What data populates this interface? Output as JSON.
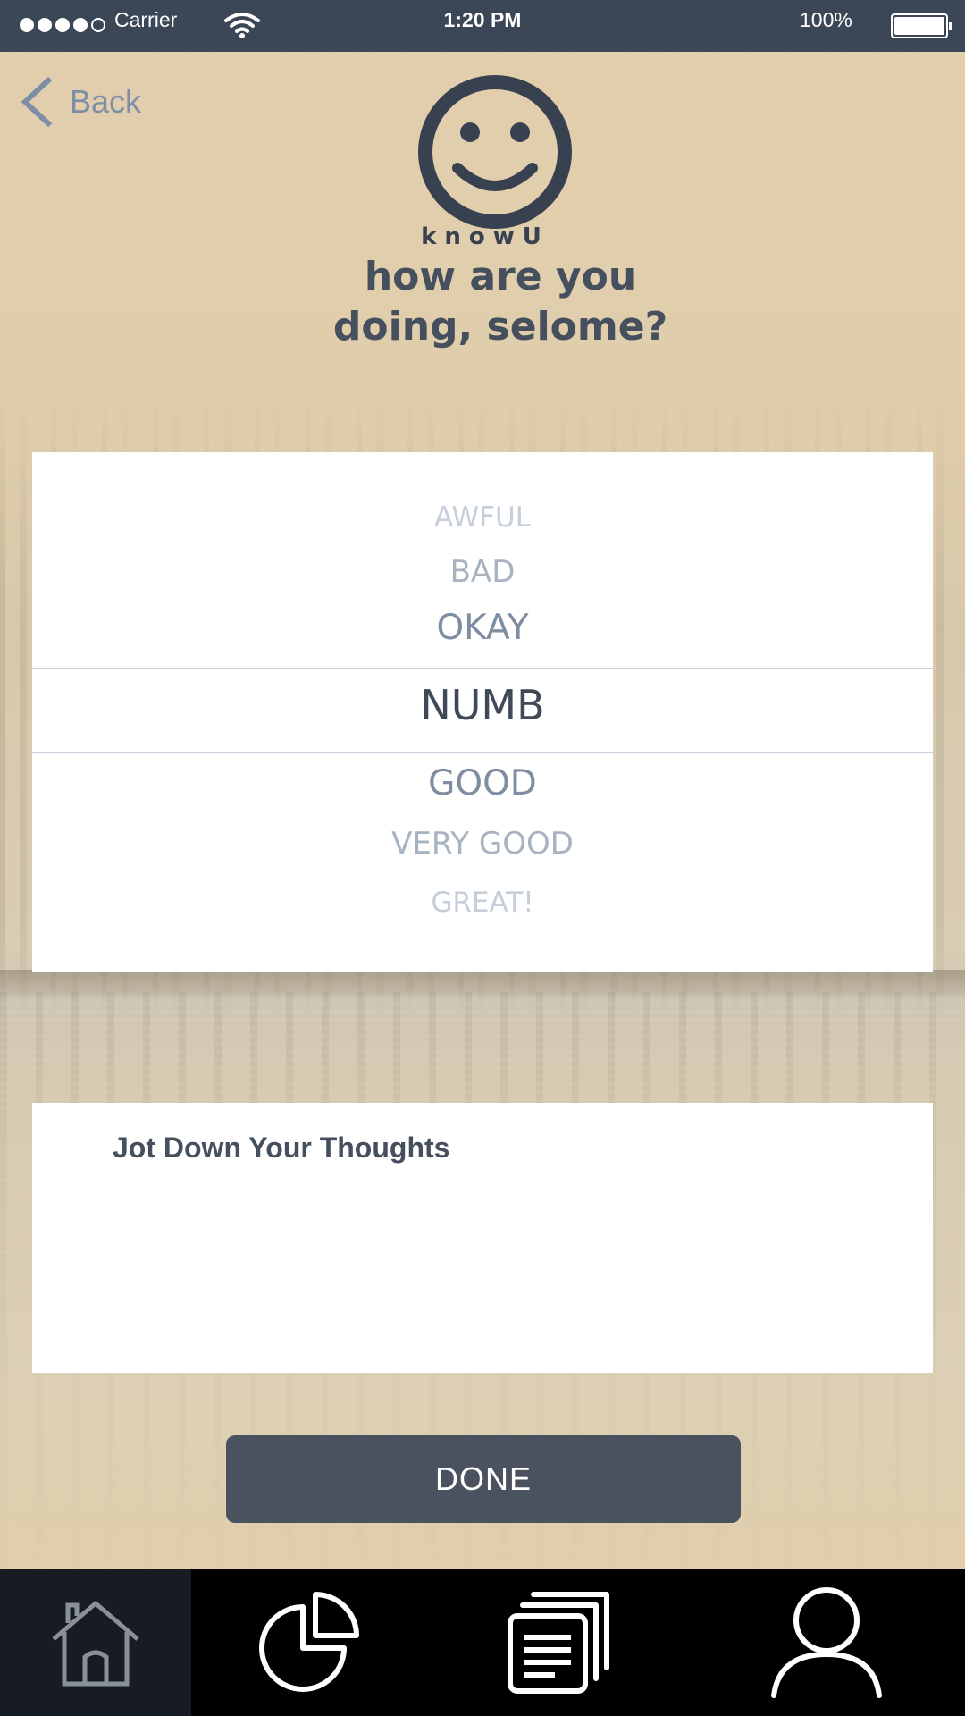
{
  "status_bar": {
    "carrier": "Carrier",
    "time": "1:20 PM",
    "battery": "100%",
    "signal_strength": 4
  },
  "header": {
    "back_label": "Back",
    "brand": "knowU",
    "greeting": "how are you doing, selome?"
  },
  "mood_picker": {
    "options": [
      "AWFUL",
      "BAD",
      "OKAY",
      "NUMB",
      "GOOD",
      "VERY GOOD",
      "GREAT!"
    ],
    "selected": "NUMB"
  },
  "thoughts": {
    "label": "Jot Down Your Thoughts",
    "value": ""
  },
  "actions": {
    "done_label": "DONE"
  },
  "tab_bar": {
    "tabs": [
      {
        "icon": "home-icon",
        "active": true
      },
      {
        "icon": "pie-chart-icon",
        "active": false
      },
      {
        "icon": "documents-icon",
        "active": false
      },
      {
        "icon": "profile-icon",
        "active": false
      }
    ]
  },
  "colors": {
    "status_bar_bg": "#3b4656",
    "accent": "#4a5260",
    "back_link": "#7d8ea6",
    "tab_bar_bg": "#000000"
  }
}
